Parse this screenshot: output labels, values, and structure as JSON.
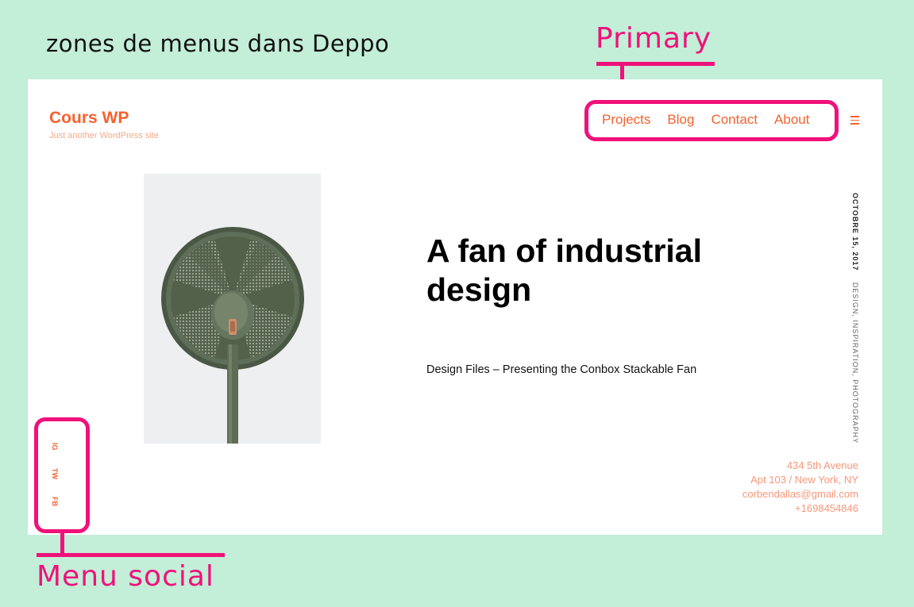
{
  "annotation": {
    "caption": "zones de menus dans Deppo",
    "primary_label": "Primary",
    "social_label": "Menu social",
    "highlight_color": "#f0117a",
    "background_color": "#c3eed8"
  },
  "site": {
    "title": "Cours WP",
    "tagline": "Just another WordPress site",
    "accent_color": "#f4622f",
    "primary_menu": [
      "Projects",
      "Blog",
      "Contact",
      "About"
    ],
    "menu_icon": "hamburger-icon",
    "social_menu": [
      "IG",
      "TW",
      "FB"
    ]
  },
  "post": {
    "title": "A fan of industrial design",
    "excerpt": "Design Files – Presenting the Conbox Stackable Fan",
    "date": "OCTOBRE 15, 2017",
    "categories": "DESIGN, INSPIRATION, PHOTOGRAPHY",
    "image_subject": "green-industrial-fan"
  },
  "contact": {
    "address_line1": "434 5th Avenue",
    "address_line2": "Apt 103 / New York, NY",
    "email": "corbendallas@gmail.com",
    "phone": "+1698454846"
  }
}
